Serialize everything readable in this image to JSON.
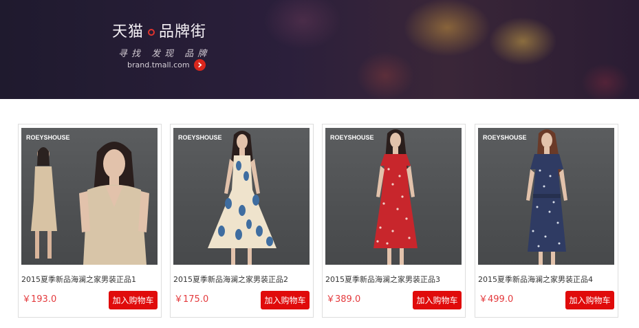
{
  "banner": {
    "brand_left": "天猫",
    "brand_right": "品牌街",
    "slogan": "寻找 发现 品牌",
    "url": "brand.tmall.com",
    "arrow_icon": "chevron-right-icon"
  },
  "colors": {
    "accent_red": "#e00b0b",
    "price_red": "#e4393c"
  },
  "products": [
    {
      "logo": "ROEYSHOUSE",
      "name": "2015夏季新品海澜之家男装正品1",
      "price": "￥193.0",
      "button": "加入购物车",
      "dress": "beige"
    },
    {
      "logo": "ROEYSHOUSE",
      "name": "2015夏季新品海澜之家男装正品2",
      "price": "￥175.0",
      "button": "加入购物车",
      "dress": "blue-print"
    },
    {
      "logo": "ROEYSHOUSE",
      "name": "2015夏季新品海澜之家男装正品3",
      "price": "￥389.0",
      "button": "加入购物车",
      "dress": "red-print"
    },
    {
      "logo": "ROEYSHOUSE",
      "name": "2015夏季新品海澜之家男装正品4",
      "price": "￥499.0",
      "button": "加入购物车",
      "dress": "navy-print"
    }
  ]
}
